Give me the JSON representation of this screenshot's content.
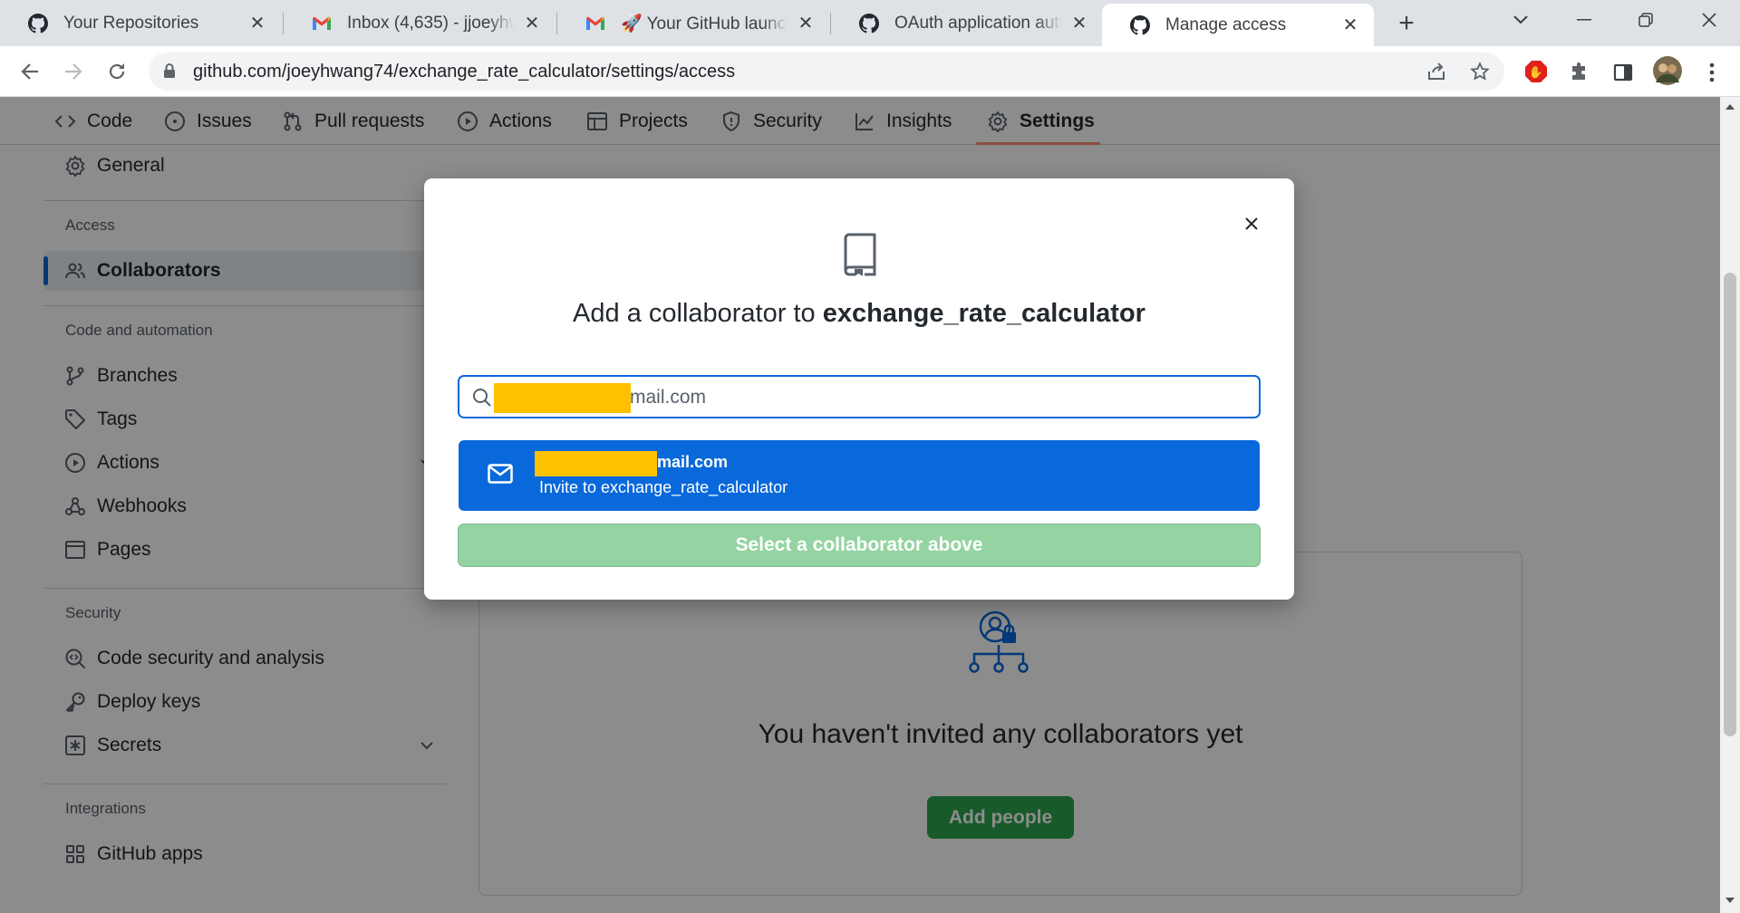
{
  "browser": {
    "tabs": [
      {
        "title": "Your Repositories",
        "icon": "github-icon"
      },
      {
        "title": "Inbox (4,635) - jjoeyhwang",
        "icon": "gmail-icon"
      },
      {
        "title": "🚀 Your GitHub launch code",
        "icon": "gmail-icon"
      },
      {
        "title": "OAuth application authorized",
        "icon": "github-icon"
      },
      {
        "title": "Manage access",
        "icon": "github-icon",
        "active": true
      }
    ],
    "url_host": "github.com",
    "url_path": "/joeyhwang74/exchange_rate_calculator/settings/access"
  },
  "repo_nav": {
    "items": [
      {
        "label": "Code",
        "icon": "code-icon"
      },
      {
        "label": "Issues",
        "icon": "issue-icon"
      },
      {
        "label": "Pull requests",
        "icon": "pull-request-icon"
      },
      {
        "label": "Actions",
        "icon": "play-icon"
      },
      {
        "label": "Projects",
        "icon": "table-icon"
      },
      {
        "label": "Security",
        "icon": "shield-icon"
      },
      {
        "label": "Insights",
        "icon": "graph-icon"
      },
      {
        "label": "Settings",
        "icon": "gear-icon",
        "selected": true
      }
    ]
  },
  "sidebar": {
    "general": "General",
    "access_heading": "Access",
    "collaborators": "Collaborators",
    "code_heading": "Code and automation",
    "branches": "Branches",
    "tags": "Tags",
    "actions": "Actions",
    "webhooks": "Webhooks",
    "pages": "Pages",
    "security_heading": "Security",
    "code_security": "Code security and analysis",
    "deploy_keys": "Deploy keys",
    "secrets": "Secrets",
    "integrations_heading": "Integrations",
    "github_apps": "GitHub apps"
  },
  "main": {
    "empty_title": "You haven't invited any collaborators yet",
    "add_people": "Add people"
  },
  "dialog": {
    "title_prefix": "Add a collaborator to",
    "repo_name": "exchange_rate_calculator",
    "search_value": "mail.com",
    "suggestion_email": "mail.com",
    "suggestion_sub": "Invite to exchange_rate_calculator",
    "select_button": "Select a collaborator above",
    "redaction_color": "#ffc000",
    "accent": "#0969da"
  }
}
